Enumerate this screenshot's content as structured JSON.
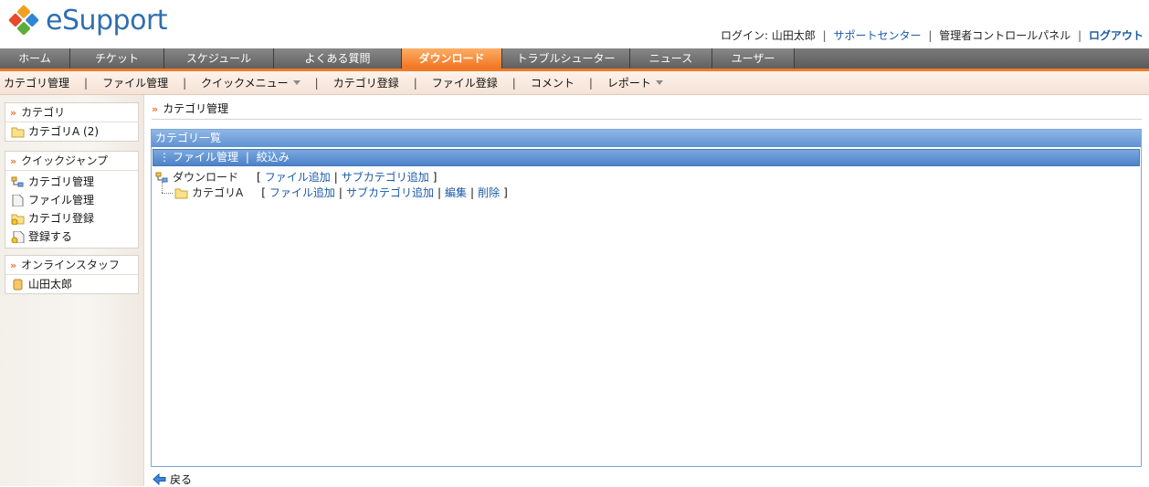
{
  "app": {
    "logo_text": "eSupport"
  },
  "toplinks": {
    "login": "ログイン: 山田太郎",
    "support_center": "サポートセンター",
    "admin_panel": "管理者コントロールパネル",
    "logout": "ログアウト",
    "sep": "|"
  },
  "mainnav": {
    "tabs": [
      {
        "label": "ホーム"
      },
      {
        "label": "チケット"
      },
      {
        "label": "スケジュール"
      },
      {
        "label": "よくある質問"
      },
      {
        "label": "ダウンロード",
        "active": true
      },
      {
        "label": "トラブルシューター"
      },
      {
        "label": "ニュース"
      },
      {
        "label": "ユーザー"
      }
    ]
  },
  "subnav": {
    "items": [
      "カテゴリ管理",
      "ファイル管理",
      "クイックメニュー",
      "カテゴリ登録",
      "ファイル登録",
      "コメント",
      "レポート"
    ],
    "sep": "|"
  },
  "sidebar": {
    "category": {
      "title": "カテゴリ",
      "items": [
        {
          "label": "カテゴリA (2)",
          "icon": "folder-icon"
        }
      ]
    },
    "quickjump": {
      "title": "クイックジャンプ",
      "items": [
        {
          "label": "カテゴリ管理",
          "icon": "tree-icon"
        },
        {
          "label": "ファイル管理",
          "icon": "file-icon"
        },
        {
          "label": "カテゴリ登録",
          "icon": "folder-add-icon"
        },
        {
          "label": "登録する",
          "icon": "file-add-icon"
        }
      ]
    },
    "staff": {
      "title": "オンラインスタッフ",
      "items": [
        {
          "label": "山田太郎",
          "icon": "user-icon"
        }
      ]
    }
  },
  "main": {
    "breadcrumb": "カテゴリ管理",
    "box_title": "カテゴリ一覧",
    "tools": {
      "file_manage": "ファイル管理",
      "filter": "絞込み",
      "sep": "|"
    },
    "tree": {
      "root": {
        "label": "ダウンロード",
        "actions": {
          "add_file": "ファイル追加",
          "add_sub": "サブカテゴリ追加"
        }
      },
      "child": {
        "label": "カテゴリA",
        "actions": {
          "add_file": "ファイル追加",
          "add_sub": "サブカテゴリ追加",
          "edit": "編集",
          "delete": "削除"
        }
      },
      "open_bracket": "[",
      "close_bracket": "]",
      "pipe": "|"
    },
    "back": "戻る"
  },
  "colors": {
    "accent": "#f07a28",
    "link": "#1a5aa8",
    "panel_blue": "#5f92d2"
  }
}
